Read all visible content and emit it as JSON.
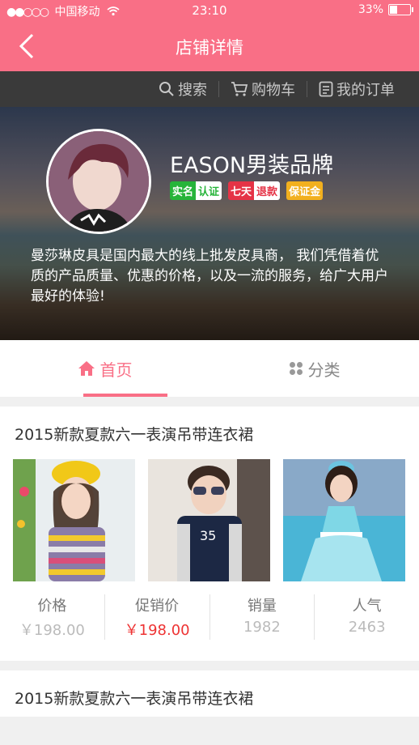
{
  "status_bar": {
    "carrier": "中国移动",
    "time": "23:10",
    "battery": "33%",
    "battery_level": 0.33
  },
  "nav": {
    "title": "店铺详情"
  },
  "toolbar": {
    "search": "搜索",
    "cart": "购物车",
    "orders": "我的订单"
  },
  "shop": {
    "name": "EASON男装品牌",
    "badges": [
      {
        "a": "实名",
        "b": "认证"
      },
      {
        "a": "七天",
        "b": "退款"
      },
      {
        "a": "保证金"
      }
    ],
    "description": "曼莎琳皮具是国内最大的线上批发皮具商， 我们凭借着优质的产品质量、优惠的价格，以及一流的服务，给广大用户最好的体验!"
  },
  "tabs": [
    {
      "label": "首页"
    },
    {
      "label": "分类"
    }
  ],
  "products": [
    {
      "title": "2015新款夏款六一表演吊带连衣裙",
      "stats": [
        {
          "label": "价格",
          "value": "￥198.00"
        },
        {
          "label": "促销价",
          "value": "￥198.00"
        },
        {
          "label": "销量",
          "value": "1982"
        },
        {
          "label": "人气",
          "value": "2463"
        }
      ]
    },
    {
      "title": "2015新款夏款六一表演吊带连衣裙"
    }
  ],
  "colors": {
    "brand": "#f96f86",
    "promo_red": "#e33333"
  }
}
